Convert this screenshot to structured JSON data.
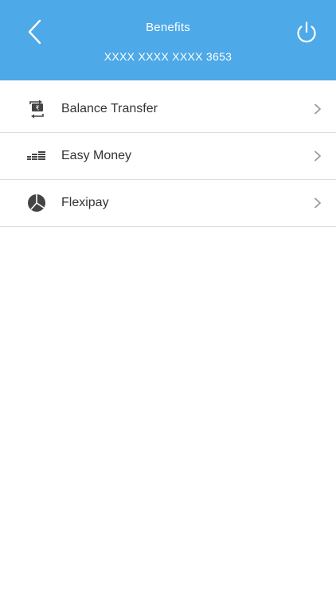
{
  "header": {
    "title": "Benefits",
    "card_number": "XXXX XXXX XXXX 3653",
    "background_color": "#4da9e8",
    "back_icon": "chevron-left-icon",
    "power_icon": "power-icon"
  },
  "benefits": {
    "items": [
      {
        "label": "Balance Transfer",
        "icon": "balance-transfer-icon"
      },
      {
        "label": "Easy Money",
        "icon": "coins-stack-icon"
      },
      {
        "label": "Flexipay",
        "icon": "pie-chart-icon"
      }
    ],
    "chevron_icon": "chevron-right-icon"
  }
}
